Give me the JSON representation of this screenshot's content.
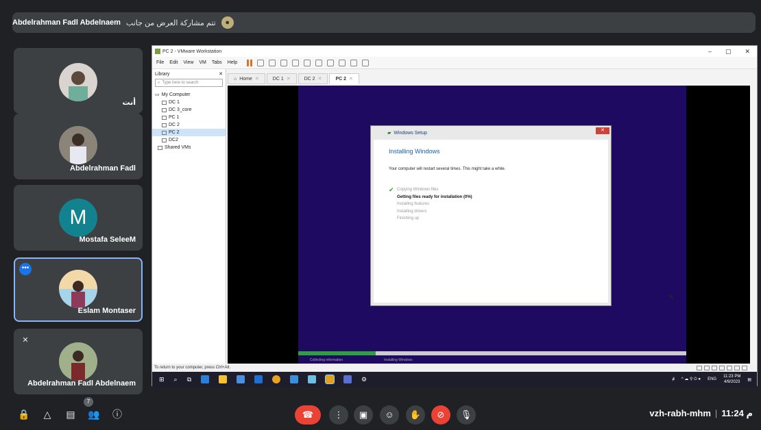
{
  "banner": {
    "presenter": "Abdelrahman Fadl Abdelnaem",
    "text": "تتم مشاركة العرض من جانب"
  },
  "participants": [
    {
      "name": "أنت",
      "photo_color": "#d9d4cf"
    },
    {
      "name": "Abdelrahman Fadl",
      "photo_color": "#8a8578"
    },
    {
      "name": "Mostafa SeleeM",
      "initial": "M",
      "color": "#12828f"
    },
    {
      "name": "Eslam Montaser",
      "photo_color": "#a7d4e8"
    },
    {
      "name": "Abdelrahman Fadl Abdelnaem",
      "photo_color": "#7f8f6f"
    }
  ],
  "vmware": {
    "title": "PC 2 - VMware Workstation",
    "menu": [
      "File",
      "Edit",
      "View",
      "VM",
      "Tabs",
      "Help"
    ],
    "library_label": "Library",
    "search_placeholder": "Type here to search",
    "tree": {
      "root": "My Computer",
      "vms": [
        "DC 1",
        "DC 3_core",
        "PC 1",
        "DC 2",
        "PC 2",
        "DC2"
      ],
      "shared": "Shared VMs"
    },
    "tabs": [
      "Home",
      "DC 1",
      "DC 2",
      "PC 2"
    ],
    "status_text": "To return to your computer, press Ctrl+Alt."
  },
  "setup": {
    "window_title": "Windows Setup",
    "heading": "Installing Windows",
    "message": "Your computer will restart several times. This might take a while.",
    "steps": [
      "Copying Windows files",
      "Getting files ready for installation (0%)",
      "Installing features",
      "Installing drivers",
      "Finishing up"
    ],
    "progress_fraction": 0.2,
    "progress_labels": [
      "Collecting information",
      "Installing Windows"
    ]
  },
  "taskbar": {
    "lang": "ENG",
    "time": "11:23 PM",
    "date": "4/9/2023"
  },
  "meet": {
    "participant_count": "7",
    "meeting_code": "vzh-rabh-mhm",
    "time": "11:24 م"
  }
}
